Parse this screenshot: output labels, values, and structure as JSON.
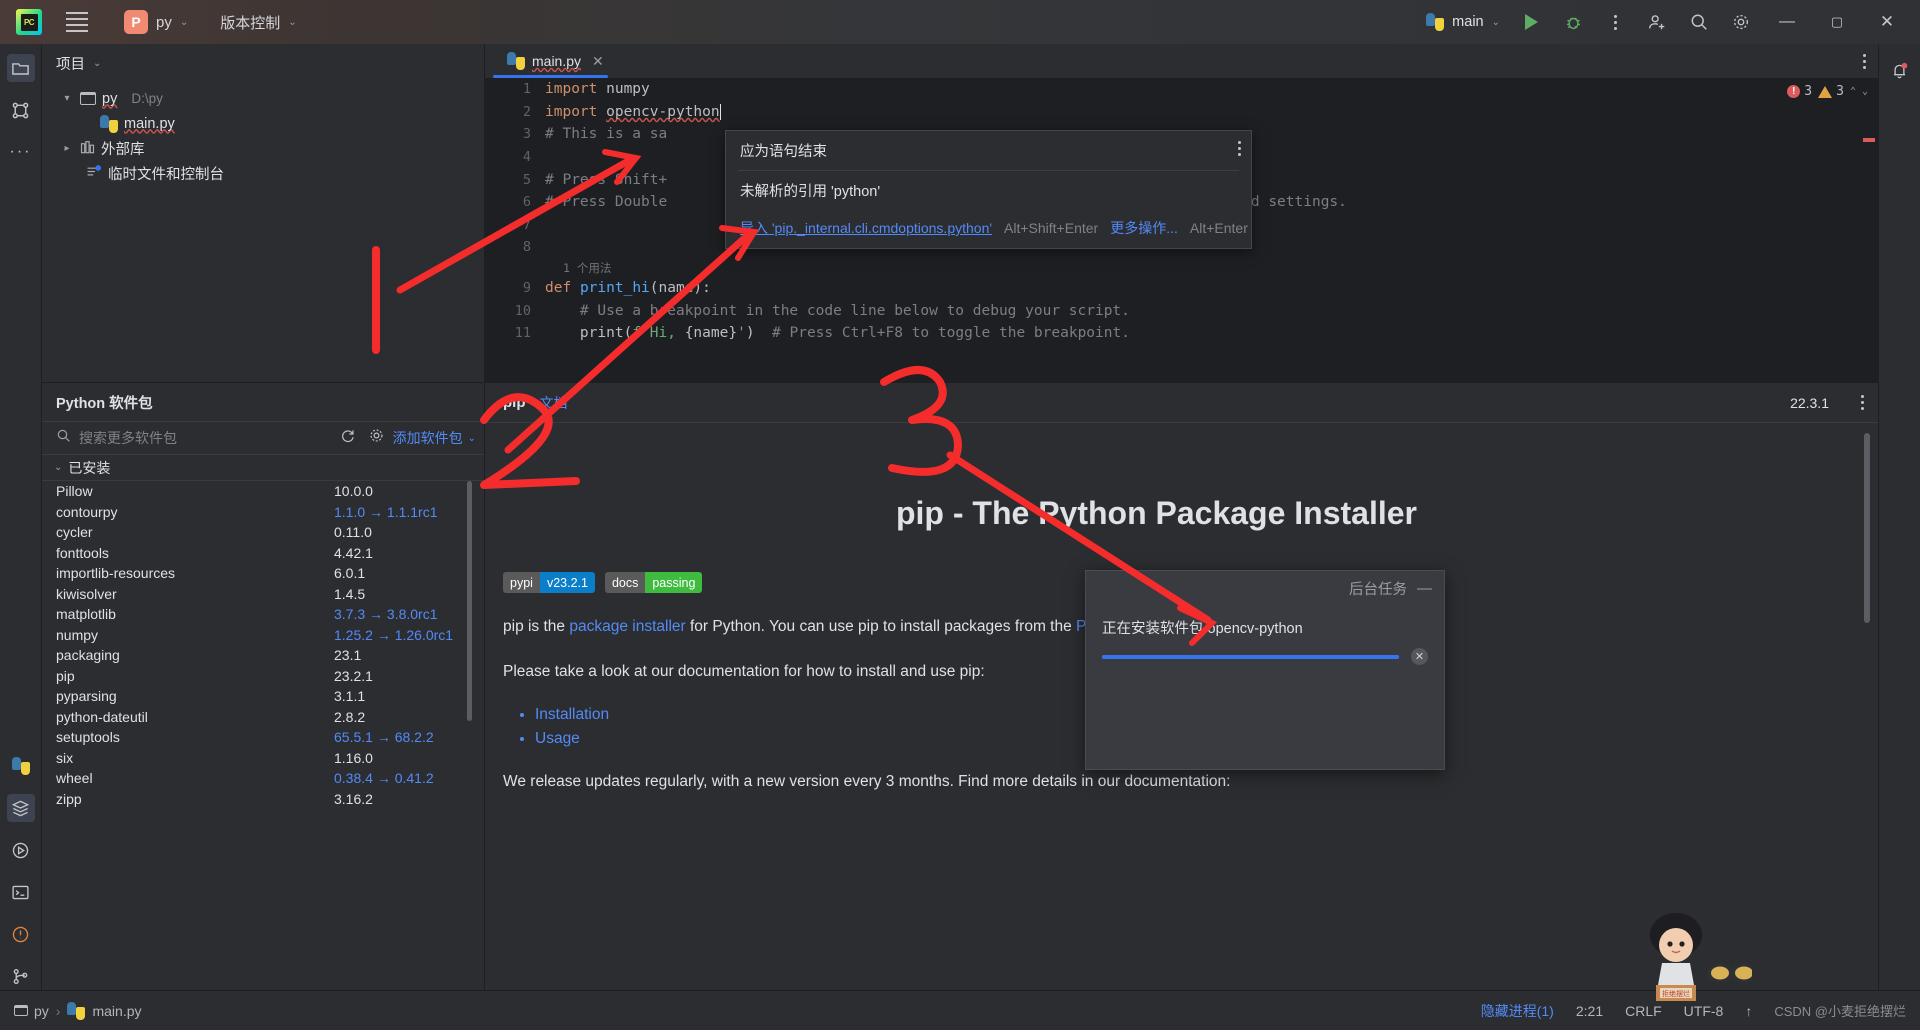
{
  "titlebar": {
    "logo_text": "PC",
    "hamburger_icon": "hamburger-icon",
    "project_initial": "P",
    "project_name": "py",
    "vcs_label": "版本控制",
    "run_config": "main",
    "run_icon": "run-icon",
    "debug_icon": "debug-icon",
    "more_icon": "more-vertical-icon",
    "account_icon": "account-add-icon",
    "search_icon": "search-icon",
    "settings_icon": "gear-icon",
    "minimize": "—",
    "maximize": "▢",
    "close": "✕"
  },
  "project_panel": {
    "header": "项目",
    "tree": [
      {
        "label": "py",
        "detail": "D:\\py",
        "icon": "folder-icon",
        "arrow": "▾",
        "indent": 0
      },
      {
        "label": "main.py",
        "detail": "",
        "icon": "python-file-icon",
        "arrow": "",
        "indent": 1
      },
      {
        "label": "外部库",
        "detail": "",
        "icon": "library-icon",
        "arrow": "▸",
        "indent": 0
      },
      {
        "label": "临时文件和控制台",
        "detail": "",
        "icon": "scratches-icon",
        "arrow": "",
        "indent": 0
      }
    ]
  },
  "packages_panel": {
    "title": "Python 软件包",
    "search_placeholder": "搜索更多软件包",
    "search_value": "",
    "refresh_icon": "refresh-icon",
    "settings_icon": "gear-icon",
    "add_package_label": "添加软件包",
    "installed_group": "已安装",
    "packages": [
      {
        "name": "Pillow",
        "version": "10.0.0",
        "update": false
      },
      {
        "name": "contourpy",
        "version": "1.1.0 → 1.1.1rc1",
        "update": true
      },
      {
        "name": "cycler",
        "version": "0.11.0",
        "update": false
      },
      {
        "name": "fonttools",
        "version": "4.42.1",
        "update": false
      },
      {
        "name": "importlib-resources",
        "version": "6.0.1",
        "update": false
      },
      {
        "name": "kiwisolver",
        "version": "1.4.5",
        "update": false
      },
      {
        "name": "matplotlib",
        "version": "3.7.3 → 3.8.0rc1",
        "update": true
      },
      {
        "name": "numpy",
        "version": "1.25.2 → 1.26.0rc1",
        "update": true
      },
      {
        "name": "packaging",
        "version": "23.1",
        "update": false
      },
      {
        "name": "pip",
        "version": "23.2.1",
        "update": false
      },
      {
        "name": "pyparsing",
        "version": "3.1.1",
        "update": false
      },
      {
        "name": "python-dateutil",
        "version": "2.8.2",
        "update": false
      },
      {
        "name": "setuptools",
        "version": "65.5.1 → 68.2.2",
        "update": true
      },
      {
        "name": "six",
        "version": "1.16.0",
        "update": false
      },
      {
        "name": "wheel",
        "version": "0.38.4 → 0.41.2",
        "update": true
      },
      {
        "name": "zipp",
        "version": "3.16.2",
        "update": false
      }
    ]
  },
  "editor": {
    "tab_label": "main.py",
    "tab_close": "✕",
    "error_count": "3",
    "warning_count": "3",
    "usage_hint": "1 个用法",
    "lines": [
      {
        "num": "1",
        "text": "import numpy"
      },
      {
        "num": "2",
        "text": "import opencv-python"
      },
      {
        "num": "3",
        "text": "# This is a sa"
      },
      {
        "num": "4",
        "text": ""
      },
      {
        "num": "5",
        "text": "# Press Shift+"
      },
      {
        "num": "6",
        "text": "# Press Double"
      },
      {
        "num": "7",
        "text": ""
      },
      {
        "num": "8",
        "text": ""
      },
      {
        "num": "9",
        "text": "def print_hi(name):"
      },
      {
        "num": "10",
        "text": "    # Use a breakpoint in the code line below to debug your script."
      },
      {
        "num": "11",
        "text": "    print(f'Hi, {name}')  # Press Ctrl+F8 to toggle the breakpoint."
      }
    ],
    "line6_tail": "s, and settings."
  },
  "tooltip": {
    "message_1": "应为语句结束",
    "message_2": "未解析的引用 'python'",
    "fix_link": "导入 'pip._internal.cli.cmdoptions.python'",
    "fix_shortcut": "Alt+Shift+Enter",
    "more_link": "更多操作...",
    "more_shortcut": "Alt+Enter",
    "kebab_icon": "more-vertical-icon"
  },
  "doc_pane": {
    "package_name": "pip",
    "doc_link": "文档",
    "version": "22.3.1",
    "kebab_icon": "more-vertical-icon",
    "heading": "pip - The Python Package Installer",
    "badges": [
      {
        "key": "pypi",
        "value": "v23.2.1",
        "color": "#0b7ec9"
      },
      {
        "key": "docs",
        "value": "passing",
        "color": "#3fbc3f"
      }
    ],
    "paragraph_1_a": "pip is the ",
    "paragraph_1_link": "package installer",
    "paragraph_1_b": " for Python. You can use pip to install packages from the ",
    "paragraph_1_link2": "Python P",
    "paragraph_2": "Please take a look at our documentation for how to install and use pip:",
    "links": [
      "Installation",
      "Usage"
    ],
    "paragraph_3": "We release updates regularly, with a new version every 3 months. Find more details in our documentation:"
  },
  "background_task": {
    "title": "后台任务",
    "minimize_icon": "minimize-icon",
    "task_text": "正在安装软件包 opencv-python",
    "cancel_icon": "close-icon",
    "progress_percent": 100
  },
  "statusbar": {
    "breadcrumb_project": "py",
    "breadcrumb_sep": "›",
    "breadcrumb_file": "main.py",
    "hidden_processes": "隐藏进程(1)",
    "caret_position": "2:21",
    "line_separator": "CRLF",
    "encoding": "UTF-8",
    "indent_icon": "arrow-up-icon",
    "watermark": "CSDN @小麦拒绝摆烂"
  },
  "left_activity_bar": [
    {
      "name": "project-icon",
      "active": true
    },
    {
      "name": "structure-icon",
      "active": false
    },
    {
      "name": "more-tool-windows-icon",
      "active": false
    }
  ],
  "left_activity_bar_bottom": [
    {
      "name": "python-console-icon",
      "active": false
    },
    {
      "name": "python-packages-icon",
      "active": true
    },
    {
      "name": "run-tool-icon",
      "active": false
    },
    {
      "name": "terminal-icon",
      "active": false
    },
    {
      "name": "problems-icon",
      "active": false
    },
    {
      "name": "git-icon",
      "active": false
    }
  ],
  "right_activity_bar": [
    {
      "name": "notifications-icon",
      "active": false
    }
  ],
  "colors": {
    "accent_blue": "#3574f0",
    "link_blue": "#548af7",
    "error_red": "#db5c5c",
    "warning_orange": "#e0a341",
    "annotation_red": "#f52c2c",
    "editor_bg": "#1e1f22",
    "panel_bg": "#2b2d30"
  },
  "annotations": [
    {
      "label": "1",
      "target": "code-line-import"
    },
    {
      "label": "2",
      "target": "tooltip-import-fix"
    },
    {
      "label": "3",
      "target": "background-task-popup"
    }
  ]
}
